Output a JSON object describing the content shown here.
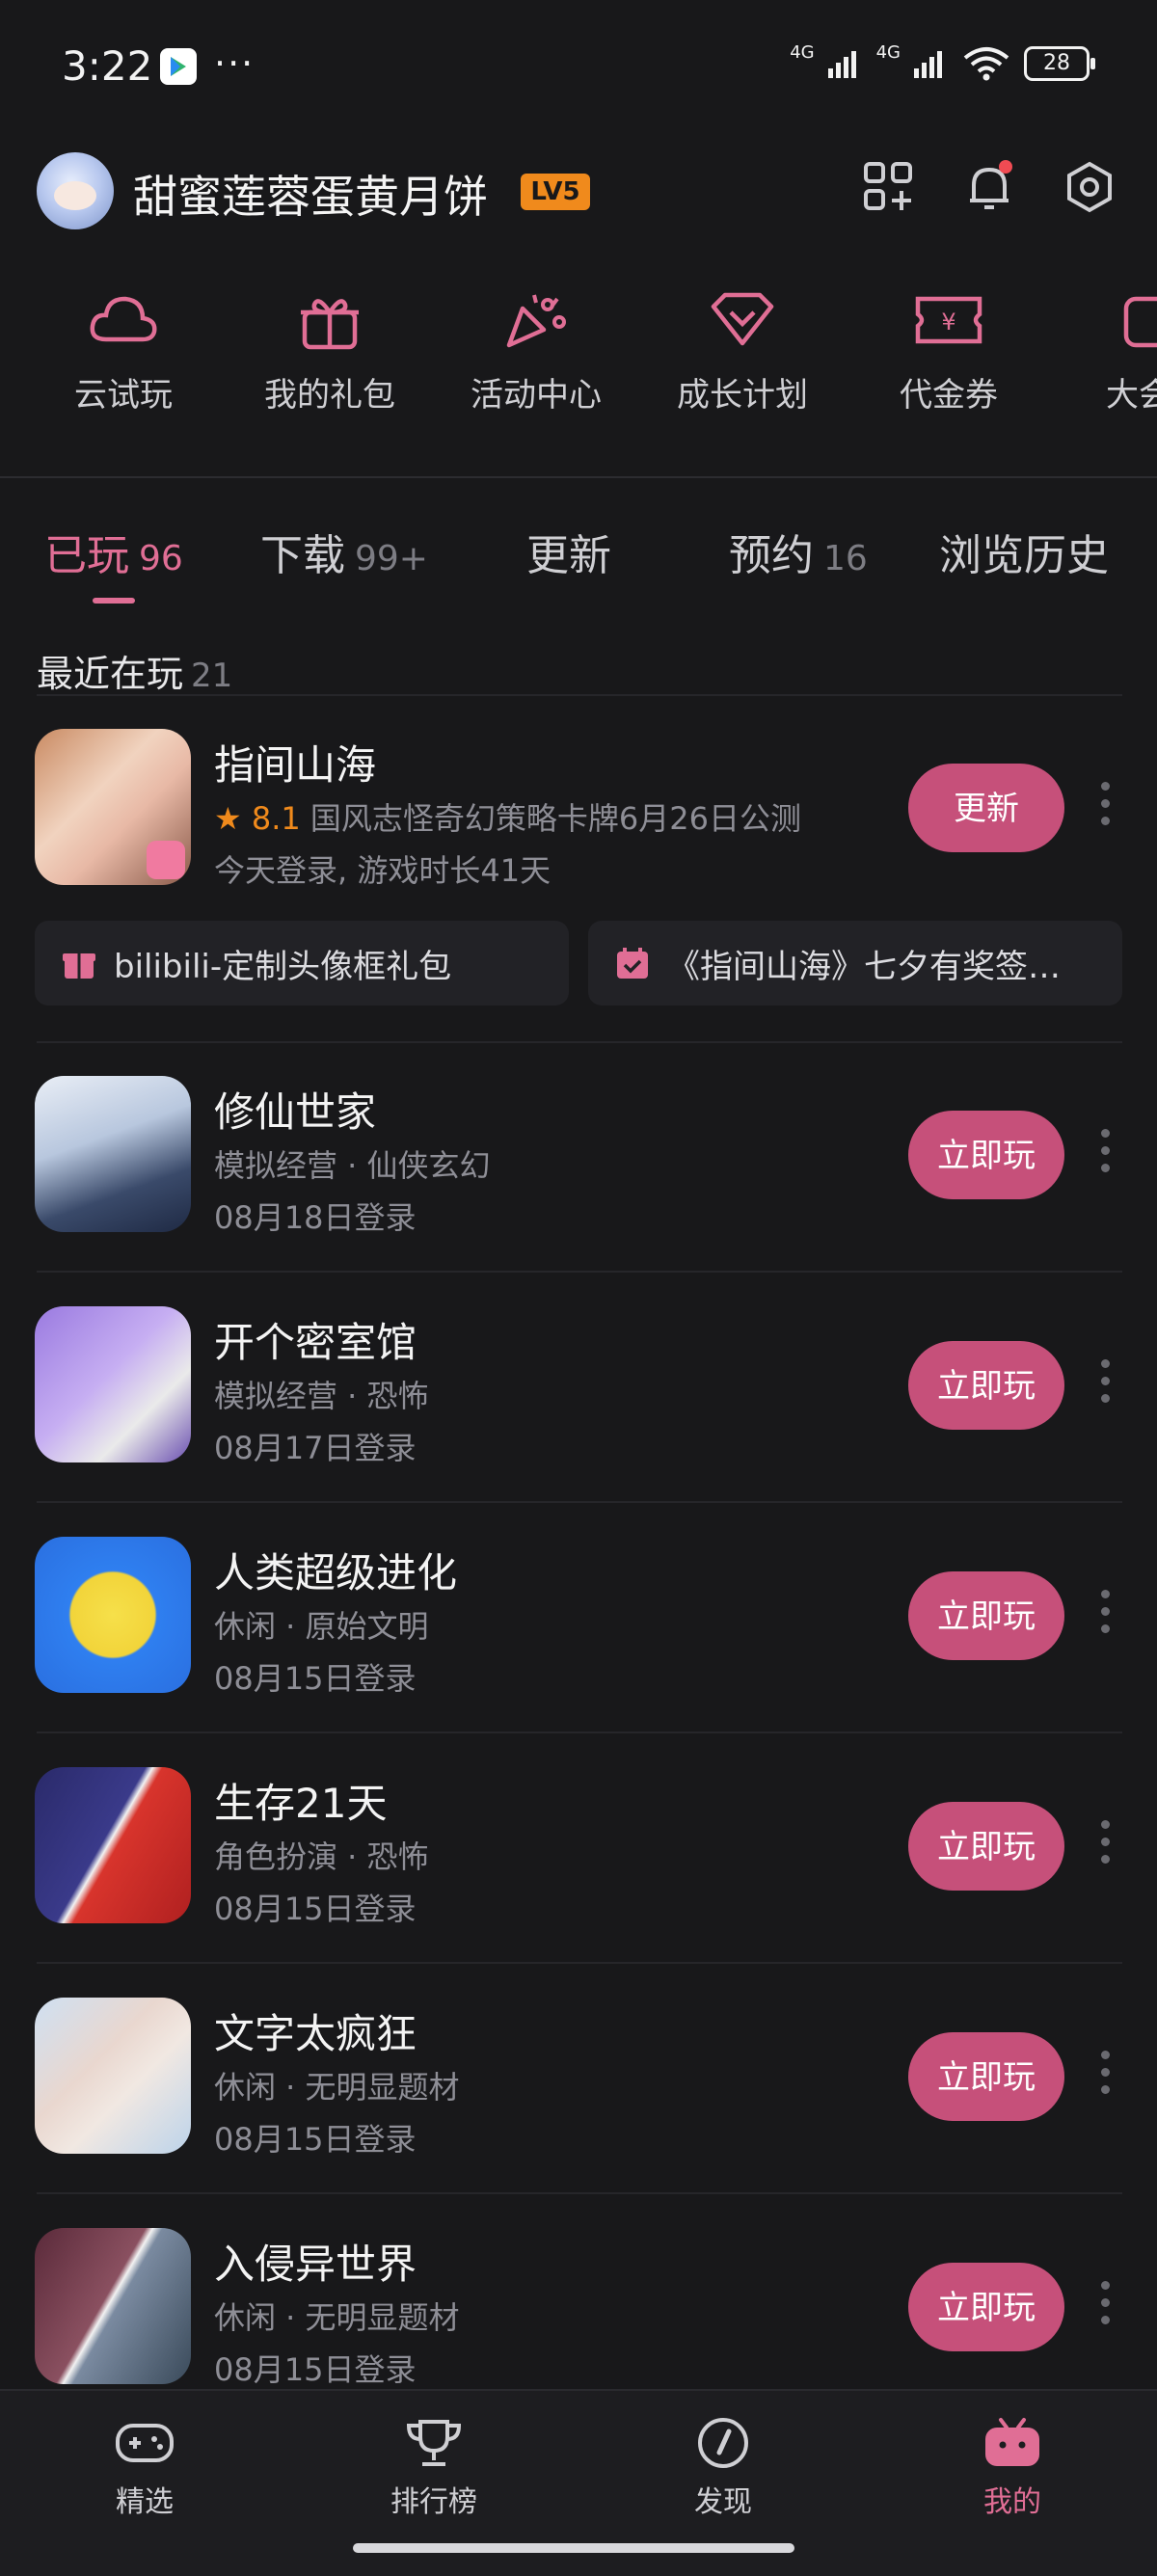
{
  "status_bar": {
    "time": "3:22",
    "dots": "···",
    "net1": "4G",
    "net2": "4G",
    "battery": "28"
  },
  "profile": {
    "username": "甜蜜莲蓉蛋黄月饼",
    "level": "LV5"
  },
  "shortcuts": [
    {
      "label": "云试玩",
      "icon": "cloud-icon"
    },
    {
      "label": "我的礼包",
      "icon": "gift-icon"
    },
    {
      "label": "活动中心",
      "icon": "party-popper-icon"
    },
    {
      "label": "成长计划",
      "icon": "heart-diamond-icon"
    },
    {
      "label": "代金券",
      "icon": "voucher-icon"
    },
    {
      "label": "大会员",
      "icon": "vip-icon"
    }
  ],
  "tabs": [
    {
      "label": "已玩",
      "count": "96",
      "active": true
    },
    {
      "label": "下载",
      "count": "99+"
    },
    {
      "label": "更新",
      "count": ""
    },
    {
      "label": "预约",
      "count": "16"
    },
    {
      "label": "浏览历史",
      "count": ""
    }
  ],
  "section": {
    "title": "最近在玩",
    "count": "21"
  },
  "featured_game": {
    "name": "指间山海",
    "rating": "8.1",
    "desc": "国风志怪奇幻策略卡牌6月26日公测",
    "date": "今天登录, 游戏时长41天",
    "button": "更新",
    "gifts": [
      "bilibili-定制头像框礼包",
      "《指间山海》七夕有奖签…"
    ]
  },
  "games": [
    {
      "name": "修仙世家",
      "tags": "模拟经营 · 仙侠玄幻",
      "date": "08月18日登录",
      "button": "立即玩"
    },
    {
      "name": "开个密室馆",
      "tags": "模拟经营 · 恐怖",
      "date": "08月17日登录",
      "button": "立即玩"
    },
    {
      "name": "人类超级进化",
      "tags": "休闲 · 原始文明",
      "date": "08月15日登录",
      "button": "立即玩"
    },
    {
      "name": "生存21天",
      "tags": "角色扮演 · 恐怖",
      "date": "08月15日登录",
      "button": "立即玩"
    },
    {
      "name": "文字太疯狂",
      "tags": "休闲 · 无明显题材",
      "date": "08月15日登录",
      "button": "立即玩"
    },
    {
      "name": "入侵异世界",
      "tags": "休闲 · 无明显题材",
      "date": "08月15日登录",
      "button": "立即玩"
    }
  ],
  "bottom_nav": [
    {
      "label": "精选",
      "icon": "gamepad-icon"
    },
    {
      "label": "排行榜",
      "icon": "trophy-icon"
    },
    {
      "label": "发现",
      "icon": "compass-icon"
    },
    {
      "label": "我的",
      "icon": "bilibili-tv-icon",
      "active": true
    }
  ],
  "colors": {
    "accent": "#e06e95",
    "button": "#c6507a",
    "background": "#18181a",
    "orange": "#f08a1c"
  }
}
